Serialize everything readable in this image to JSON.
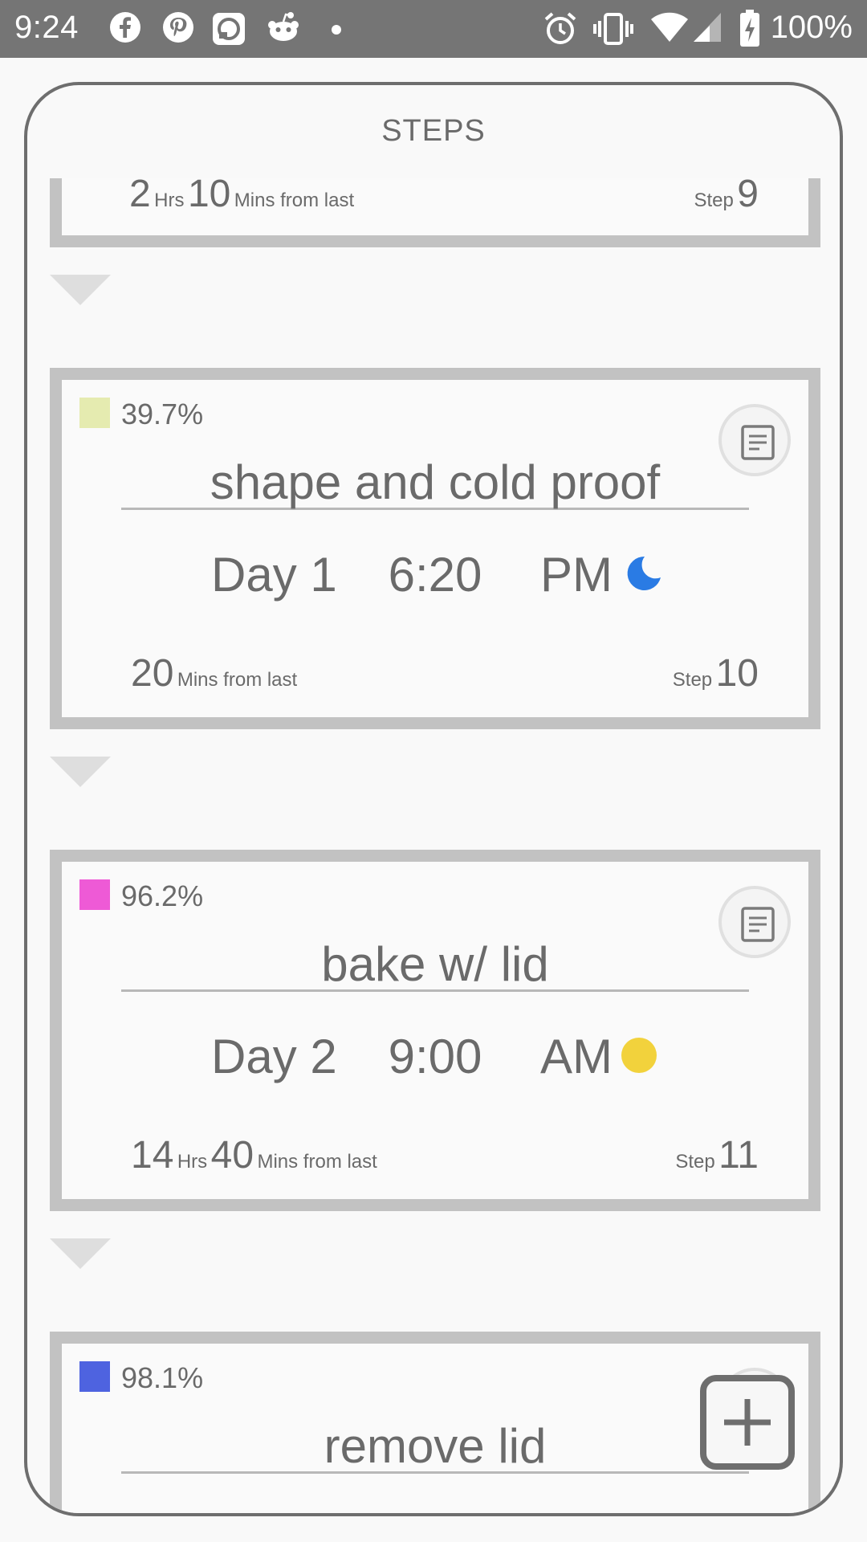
{
  "status_bar": {
    "time": "9:24",
    "battery": "100%",
    "notification_icons": [
      "facebook-icon",
      "pinterest-icon",
      "app-square-icon",
      "reddit-icon",
      "dot-icon"
    ],
    "system_icons": [
      "alarm-icon",
      "vibrate-icon",
      "wifi-icon",
      "signal-icon",
      "battery-charging-icon"
    ]
  },
  "frame": {
    "title": "STEPS"
  },
  "steps": [
    {
      "gap_hrs": "2",
      "hrs_unit": "Hrs",
      "gap_mins": "10",
      "from_last": "Mins from last",
      "step_label": "Step",
      "step_number": "9"
    },
    {
      "swatch_color": "#e5ebb0",
      "percent": "39.7%",
      "name": "shape and cold proof",
      "day": "Day 1",
      "time": "6:20",
      "ampm": "PM",
      "daynight_icon": "moon-icon",
      "daynight_color": "#2a7be4",
      "gap_mins": "20",
      "from_last": "Mins from last",
      "step_label": "Step",
      "step_number": "10"
    },
    {
      "swatch_color": "#ee5ad6",
      "percent": "96.2%",
      "name": "bake w/ lid",
      "day": "Day 2",
      "time": "9:00",
      "ampm": "AM",
      "daynight_icon": "sun-icon",
      "daynight_color": "#f2d23c",
      "gap_hrs": "14",
      "hrs_unit": "Hrs",
      "gap_mins": "40",
      "from_last": "Mins from last",
      "step_label": "Step",
      "step_number": "11"
    },
    {
      "swatch_color": "#4e63e0",
      "percent": "98.1%",
      "name": "remove lid"
    }
  ],
  "colors": {
    "status_bar": "#757575",
    "card_border": "#c2c2c2",
    "arrow": "#dedede",
    "frame_border": "#6e6e6e"
  }
}
